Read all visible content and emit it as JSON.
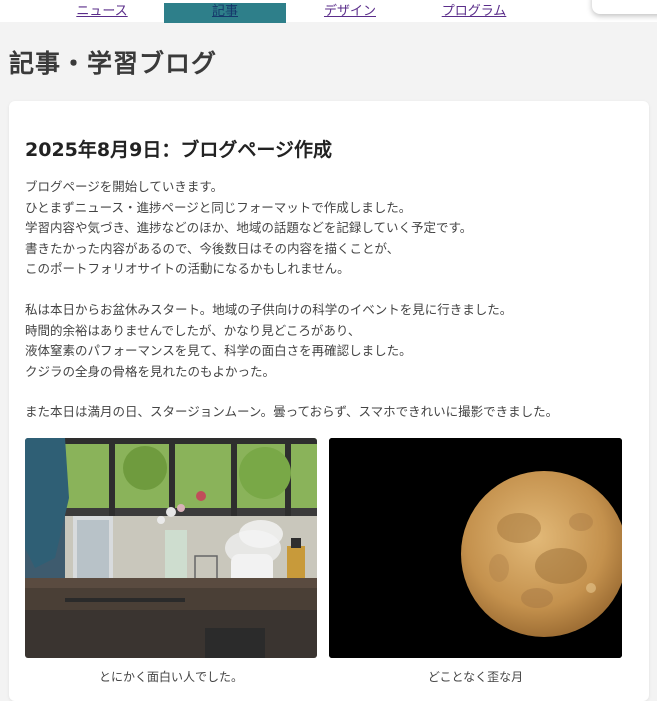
{
  "nav": {
    "items": [
      {
        "label": "ニュース",
        "active": false
      },
      {
        "label": "記事",
        "active": true
      },
      {
        "label": "デザイン",
        "active": false
      },
      {
        "label": "プログラム",
        "active": false
      }
    ],
    "active_color": "#2e7f8a"
  },
  "page": {
    "title": "記事・学習ブログ"
  },
  "post": {
    "title": "2025年8月9日：ブログページ作成",
    "paragraphs": [
      [
        "ブログページを開始していきます。",
        "ひとまずニュース・進捗ページと同じフォーマットで作成しました。",
        "学習内容や気づき、進捗などのほか、地域の話題などを記録していく予定です。",
        "書きたかった内容があるので、今後数日はその内容を描くことが、",
        "このポートフォリオサイトの活動になるかもしれません。"
      ],
      [
        "私は本日からお盆休みスタート。地域の子供向けの科学のイベントを見に行きました。",
        "時間的余裕はありませんでしたが、かなり見どころがあり、",
        "液体窒素のパフォーマンスを見て、科学の面白さを再確認しました。",
        "クジラの全身の骨格を見れたのもよかった。"
      ],
      [
        "また本日は満月の日、スタージョンムーン。曇っておらず、スマホできれいに撮影できました。"
      ]
    ],
    "images": [
      {
        "icon": "science-event-photo",
        "caption": "とにかく面白い人でした。"
      },
      {
        "icon": "full-moon-photo",
        "caption": "どことなく歪な月"
      }
    ]
  }
}
